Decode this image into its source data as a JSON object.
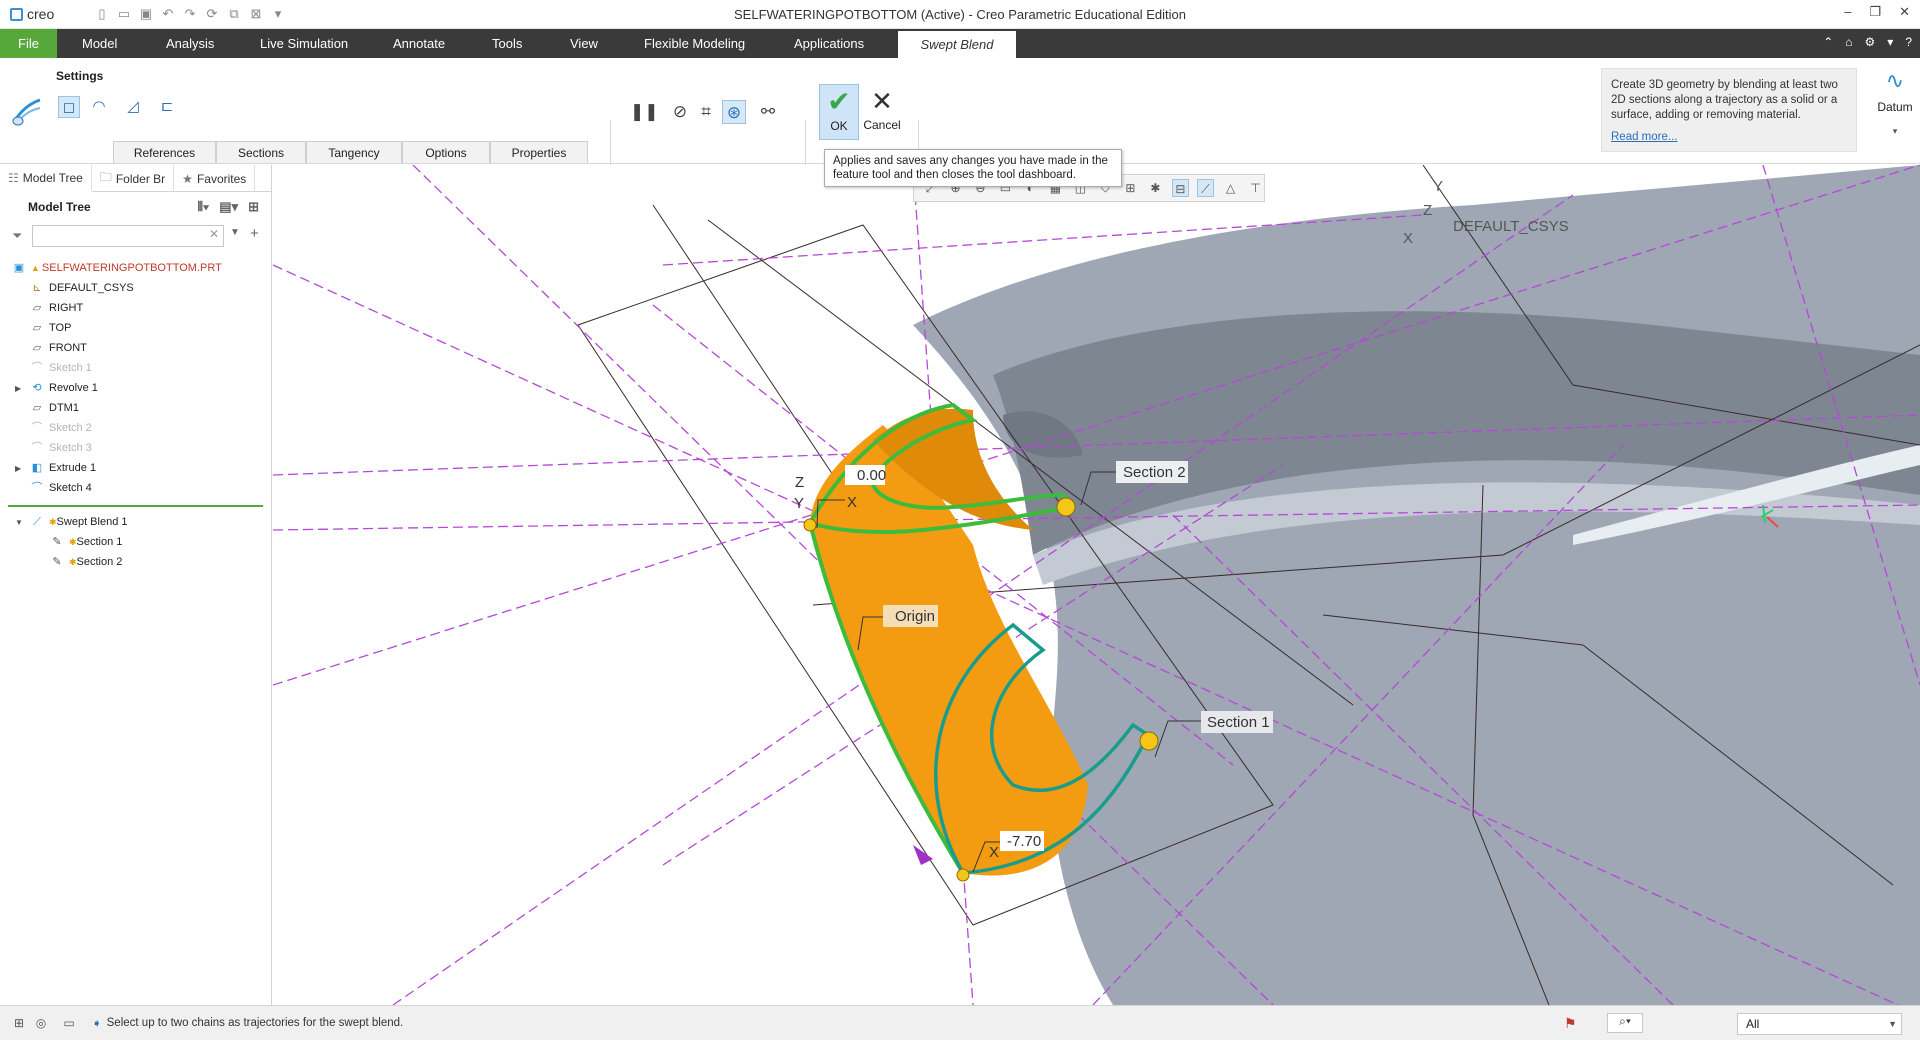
{
  "app": {
    "logo_text": "creo",
    "window_title": "SELFWATERINGPOTBOTTOM (Active) - Creo Parametric Educational Edition",
    "window_controls": [
      "–",
      "❐",
      "✕"
    ]
  },
  "ribbon_tabs": {
    "file": "File",
    "model": "Model",
    "analysis": "Analysis",
    "live_simulation": "Live Simulation",
    "annotate": "Annotate",
    "tools": "Tools",
    "view": "View",
    "flexible_modeling": "Flexible Modeling",
    "applications": "Applications",
    "swept_blend": "Swept Blend"
  },
  "dashboard": {
    "settings_label": "Settings",
    "subtabs": {
      "references": "References",
      "sections": "Sections",
      "tangency": "Tangency",
      "options": "Options",
      "properties": "Properties"
    },
    "ok_label": "OK",
    "cancel_label": "Cancel",
    "tooltip": "Applies and saves any changes you have made in the feature tool and then closes the tool dashboard.",
    "help_text": "Create 3D geometry by blending at least two 2D sections along a trajectory as a solid or a surface, adding or removing material.",
    "help_link": "Read more...",
    "datum_label": "Datum"
  },
  "left_panel": {
    "tabs": {
      "model_tree": "Model Tree",
      "folder_browser": "Folder Br",
      "favorites": "Favorites"
    },
    "tree_title": "Model Tree",
    "filter_placeholder": "",
    "items": [
      {
        "label": "SELFWATERINGPOTBOTTOM.PRT",
        "icon": "part-icon"
      },
      {
        "label": "DEFAULT_CSYS",
        "icon": "csys-icon"
      },
      {
        "label": "RIGHT",
        "icon": "plane-icon"
      },
      {
        "label": "TOP",
        "icon": "plane-icon"
      },
      {
        "label": "FRONT",
        "icon": "plane-icon"
      },
      {
        "label": "Sketch 1",
        "icon": "sketch-icon"
      },
      {
        "label": "Revolve 1",
        "icon": "revolve-icon"
      },
      {
        "label": "DTM1",
        "icon": "plane-icon"
      },
      {
        "label": "Sketch 2",
        "icon": "sketch-icon"
      },
      {
        "label": "Sketch 3",
        "icon": "sketch-icon"
      },
      {
        "label": "Extrude 1",
        "icon": "extrude-icon"
      },
      {
        "label": "Sketch 4",
        "icon": "sketch-icon"
      },
      {
        "label": "Swept Blend 1",
        "icon": "swept-blend-icon"
      },
      {
        "label": "Section 1",
        "icon": "section-icon"
      },
      {
        "label": "Section 2",
        "icon": "section-icon"
      }
    ]
  },
  "viewport": {
    "csys_label": "DEFAULT_CSYS",
    "axis_y": "Y",
    "axis_z": "Z",
    "axis_x": "X",
    "dim_top": "0.00",
    "dim_bottom": "-7.70",
    "section2_tag": "Section 2",
    "section1_tag": "Section 1",
    "origin_tag": "Origin"
  },
  "statusbar": {
    "message": "Select up to two chains as trajectories for the swept blend.",
    "filter_value": "All"
  },
  "colors": {
    "file_tab": "#57a83a",
    "ribbon_dark": "#3a3a3a",
    "accent_blue": "#2a6fb8",
    "blend_orange": "#f39c12",
    "chain_green": "#3dbb3d",
    "datum_magenta": "#b548d6"
  }
}
